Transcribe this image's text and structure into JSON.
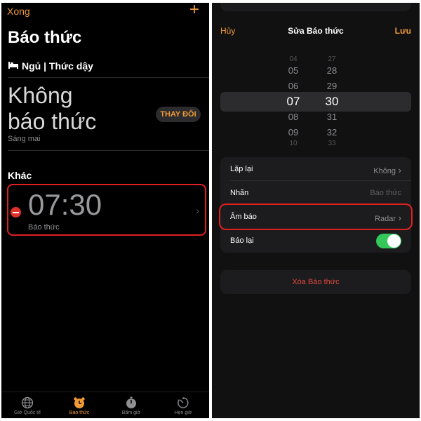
{
  "left": {
    "done_label": "Xong",
    "add_label": "+",
    "title": "Báo thức",
    "sleep": {
      "heading": "Ngủ | Thức dậy",
      "no_alarm_line1": "Không",
      "no_alarm_line2": "báo thức",
      "subtitle": "Sáng mai",
      "change_button": "THAY ĐỔI"
    },
    "other_heading": "Khác",
    "alarm": {
      "time": "07:30",
      "label": "Báo thức"
    },
    "tabs": [
      {
        "label": "Giờ Quốc tế",
        "icon": "globe-icon",
        "active": false
      },
      {
        "label": "Báo thức",
        "icon": "alarm-clock-icon",
        "active": true
      },
      {
        "label": "Bấm giờ",
        "icon": "stopwatch-icon",
        "active": false
      },
      {
        "label": "Hẹn giờ",
        "icon": "timer-icon",
        "active": false
      }
    ]
  },
  "right": {
    "cancel_label": "Hủy",
    "title": "Sửa Báo thức",
    "save_label": "Lưu",
    "picker": {
      "hours": [
        "04",
        "05",
        "06",
        "07",
        "08",
        "09",
        "10"
      ],
      "minutes": [
        "27",
        "28",
        "29",
        "30",
        "31",
        "32",
        "33"
      ],
      "selected_hour": "07",
      "selected_minute": "30"
    },
    "rows": {
      "repeat": {
        "label": "Lặp lại",
        "value": "Không"
      },
      "label": {
        "label": "Nhãn",
        "placeholder": "Báo thức"
      },
      "sound": {
        "label": "Âm báo",
        "value": "Radar"
      },
      "snooze": {
        "label": "Báo lại",
        "on": true
      }
    },
    "delete_label": "Xóa Báo thức"
  },
  "colors": {
    "accent": "#f09a37",
    "highlight": "#e02020",
    "toggle_on": "#34c759",
    "destructive": "#e0483e"
  }
}
